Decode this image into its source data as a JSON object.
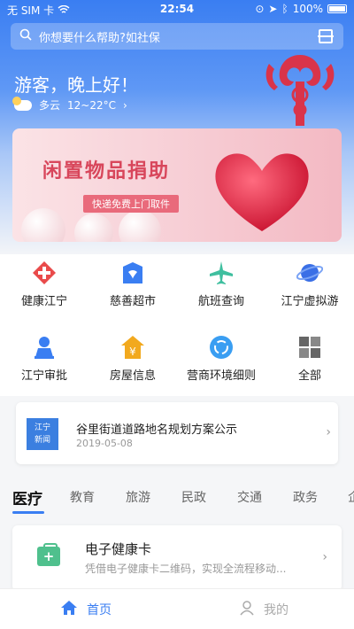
{
  "status": {
    "carrier": "无 SIM 卡",
    "time": "22:54",
    "battery": "100%"
  },
  "search": {
    "placeholder": "你想要什么帮助?如社保"
  },
  "greeting": "游客，晚上好！",
  "weather": {
    "condition": "多云",
    "temperature": "12~22°C"
  },
  "banner": {
    "title": "闲置物品捐助",
    "subtitle": "快递免费上门取件"
  },
  "services": [
    {
      "label": "健康江宁",
      "icon": "health-cross-icon",
      "color": "#e94b4b"
    },
    {
      "label": "慈善超市",
      "icon": "store-icon",
      "color": "#3a7ef2"
    },
    {
      "label": "航班查询",
      "icon": "airplane-icon",
      "color": "#3fbf9f"
    },
    {
      "label": "江宁虚拟游",
      "icon": "planet-icon",
      "color": "#3a6fe6"
    },
    {
      "label": "江宁审批",
      "icon": "approval-person-icon",
      "color": "#3a7ef2"
    },
    {
      "label": "房屋信息",
      "icon": "house-yuan-icon",
      "color": "#f2a91e"
    },
    {
      "label": "营商环境细则",
      "icon": "refresh-circle-icon",
      "color": "#3a9ef2"
    },
    {
      "label": "全部",
      "icon": "grid-icon",
      "color": "#666666"
    }
  ],
  "news": {
    "logo_text_1": "江宁",
    "logo_text_2": "新闻",
    "headline": "谷里街道道路地名规划方案公示",
    "date": "2019-05-08"
  },
  "tabs": [
    "医疗",
    "教育",
    "旅游",
    "民政",
    "交通",
    "政务",
    "企"
  ],
  "card": {
    "title": "电子健康卡",
    "desc": "凭借电子健康卡二维码，实现全流程移动..."
  },
  "nav": {
    "home": "首页",
    "mine": "我的"
  },
  "colors": {
    "accent": "#3a7ef2",
    "brand_red": "#d8465b"
  }
}
